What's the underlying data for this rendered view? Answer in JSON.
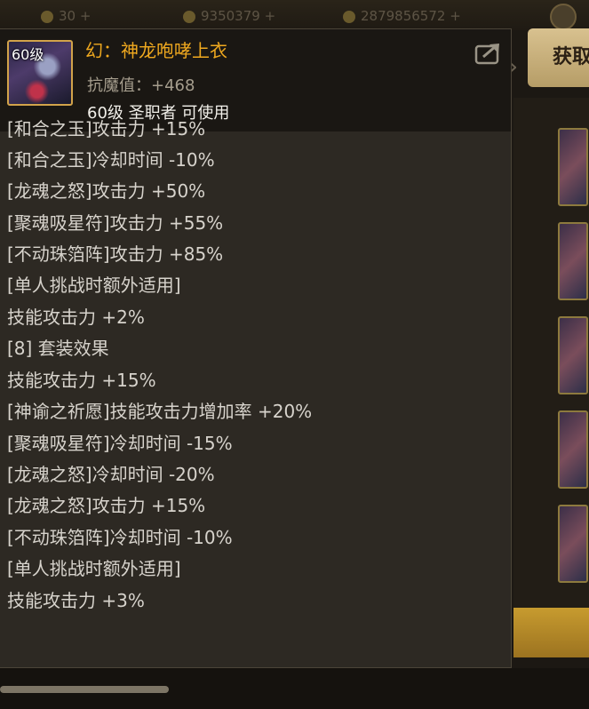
{
  "background": {
    "stats": [
      "30 +",
      "9350379 +",
      "2879856572 +"
    ],
    "acquire_label": "获取"
  },
  "item": {
    "level_badge": "60级",
    "name": "幻：神龙咆哮上衣",
    "attribute": "抗魔值：+468",
    "requirement": "60级 圣职者 可使用",
    "name_color": "#f0a91f"
  },
  "effects": [
    "[和合之玉]攻击力 +15%",
    "[和合之玉]冷却时间 -10%",
    "[龙魂之怒]攻击力 +50%",
    "[聚魂吸星符]攻击力 +55%",
    "[不动珠箔阵]攻击力 +85%",
    "[单人挑战时额外适用]",
    "技能攻击力 +2%",
    "[8] 套装效果",
    "技能攻击力 +15%",
    "[神谕之祈愿]技能攻击力增加率 +20%",
    "[聚魂吸星符]冷却时间 -15%",
    "[龙魂之怒]冷却时间 -20%",
    "[龙魂之怒]攻击力 +15%",
    "[不动珠箔阵]冷却时间 -10%",
    "[单人挑战时额外适用]",
    "技能攻击力 +3%"
  ]
}
